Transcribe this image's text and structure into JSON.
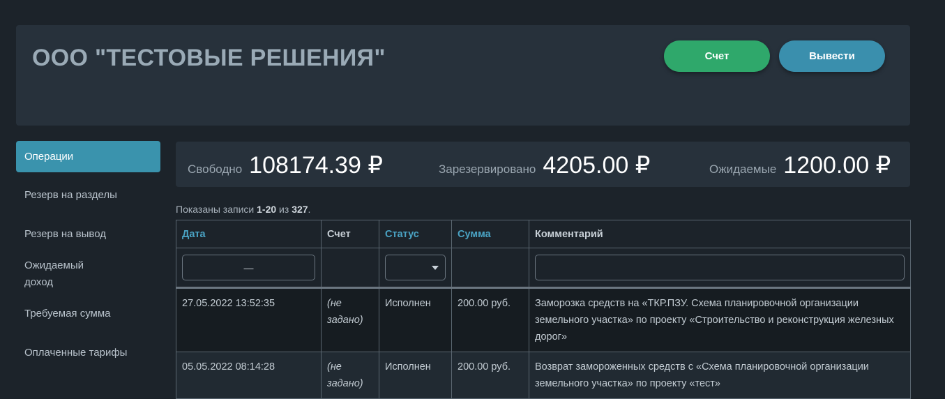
{
  "header": {
    "company": "ООО \"ТЕСТОВЫЕ РЕШЕНИЯ\"",
    "account_button": "Счет",
    "withdraw_button": "Вывести"
  },
  "sidebar": {
    "items": [
      {
        "label": "Операции",
        "active": true
      },
      {
        "label": "Резерв на разделы"
      },
      {
        "label": "Резерв на вывод"
      },
      {
        "label": "Ожидаемый доход"
      },
      {
        "label": "Требуемая сумма"
      },
      {
        "label": "Оплаченные тарифы"
      }
    ]
  },
  "balances": {
    "free_label": "Свободно",
    "free_value": "108174.39 ₽",
    "reserved_label": "Зарезервировано",
    "reserved_value": "4205.00 ₽",
    "expected_label": "Ожидаемые",
    "expected_value": "1200.00 ₽"
  },
  "records": {
    "prefix": "Показаны записи ",
    "range": "1-20",
    "of": " из ",
    "total": "327",
    "suffix": "."
  },
  "table": {
    "headers": [
      "Дата",
      "Счет",
      "Статус",
      "Сумма",
      "Комментарий"
    ],
    "date_filter_value": "—",
    "rows": [
      {
        "date": "27.05.2022 13:52:35",
        "account": "(не задано)",
        "status": "Исполнен",
        "amount": "200.00 руб.",
        "comment": "Заморозка средств на «ТКР.ПЗУ. Схема планировочной организации земельного участка» по проекту «Строительство и реконструкция железных дорог»"
      },
      {
        "date": "05.05.2022 08:14:28",
        "account": "(не задано)",
        "status": "Исполнен",
        "amount": "200.00 руб.",
        "comment": "Возврат замороженных средств с «Схема планировочной организации земельного участка» по проекту «тест»"
      }
    ]
  }
}
